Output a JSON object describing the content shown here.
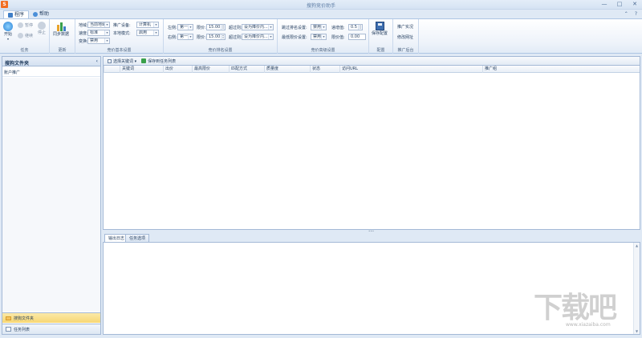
{
  "window": {
    "title": "搜狗竞价助手",
    "minimize": "—",
    "maximize": "□",
    "close": "✕"
  },
  "tabs": [
    {
      "label": "程序"
    },
    {
      "label": "帮助"
    }
  ],
  "tabrow_right": {
    "up": "⌃",
    "help": "?"
  },
  "ribbon": {
    "task": {
      "label": "任务",
      "start": "开始",
      "pause": "暂停",
      "resume": "继续",
      "stop": "停止"
    },
    "update": {
      "label": "更新",
      "sync": "同步数据"
    },
    "basic": {
      "label": "竞价基本设置",
      "region_label": "地域:",
      "region_value": "当前地域",
      "speed_label": "速度:",
      "speed_value": "标准",
      "proxy_label": "变换:",
      "proxy_value": "禁用",
      "device_label": "推广设备:",
      "device_value": "计算机",
      "local_label": "本地模式:",
      "local_value": "启用"
    },
    "rank": {
      "label": "竞价排名设置",
      "left_label": "左侧:",
      "left_value": "第一",
      "right_label": "右侧:",
      "right_value": "第一",
      "limit1_label": "限价:",
      "limit1_value": "15.00",
      "limit2_label": "限价:",
      "limit2_value": "15.00",
      "over1_label": "超过则:",
      "over1_value": "设为降价内...",
      "over2_label": "超过则:",
      "over2_value": "设为降价内..."
    },
    "advanced": {
      "label": "竞价高级设置",
      "skip_label": "跳过排名设置:",
      "skip_value": "禁用",
      "lowest_label": "最低限价设置:",
      "lowest_value": "禁用",
      "step_label": "递增值:",
      "step_value": "0.5",
      "floor_label": "限价值:",
      "floor_value": "0.00"
    },
    "config": {
      "label": "配置",
      "save": "保存配置"
    },
    "promo": {
      "label": "推广后台",
      "link1": "推广实况",
      "link2": "修改网址"
    }
  },
  "left_panel": {
    "header": "搜狗文件夹",
    "collapse": "‹",
    "item": "账户推广",
    "nav": [
      {
        "label": "搜狗文件夹"
      },
      {
        "label": "任务列表"
      }
    ]
  },
  "toolbar": {
    "select_keywords": "选择关键词 ▾",
    "save_to_tasklist": "保存到任务列表"
  },
  "grid": {
    "columns": [
      "关键词",
      "出价",
      "最高限价",
      "匹配方式",
      "质量度",
      "状态",
      "访问URL",
      "推广组"
    ]
  },
  "log": {
    "tabs": [
      "输出日志",
      "任务选项"
    ]
  },
  "watermark": {
    "text": "下载吧",
    "url": "www.xiazaiba.com"
  }
}
